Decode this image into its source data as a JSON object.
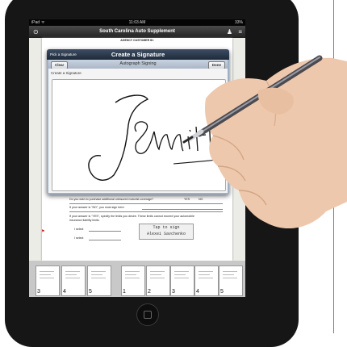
{
  "status_bar": {
    "device": "iPad",
    "signal": "ᯤ",
    "time": "11:03 AM",
    "battery": "33%"
  },
  "app_header": {
    "title": "South Carolina Auto Supplement"
  },
  "document": {
    "agency_label": "AGENCY CUSTOMER ID:",
    "question_1": "Do you wish to purchase additional uninsured motorist coverage?",
    "yes": "YES",
    "no": "NO",
    "question_2": "If your answer is \"NO\", you must sign here:",
    "question_3a": "If your answer is \"YES\", specify the limits you desire. These limits cannot exceed your automobile",
    "question_3b": "insurance liability limits.",
    "selected_1": "I select",
    "selected_2": "I select",
    "tap_to_sign": "Tap to sign",
    "signer_name": "Alexei Savchenko"
  },
  "modal": {
    "pick_label": "Pick a Signature",
    "title": "Create a Signature",
    "clear_button": "Clear",
    "bar_title": "Autograph Signing",
    "done_button": "Done",
    "sub_label": "Create a Signature"
  },
  "thumbnails": [
    "3",
    "4",
    "5",
    "1",
    "2",
    "3",
    "4",
    "5"
  ],
  "colors": {
    "header": "#2e2e2e",
    "modal_nav": "#2a374b",
    "modal_bar": "#b9c4d3",
    "flag": "#c02020"
  }
}
